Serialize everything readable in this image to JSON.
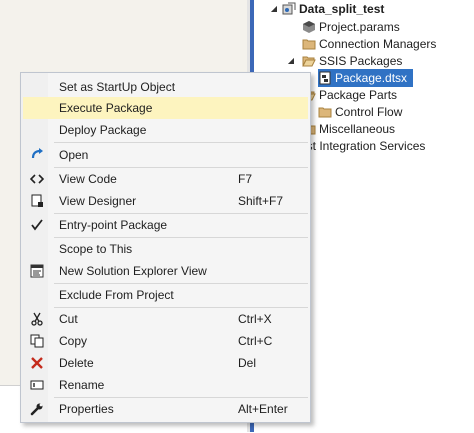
{
  "solution_explorer": {
    "project": "Data_split_test",
    "project_params": "Project.params",
    "connection_managers": "Connection Managers",
    "ssis_packages": "SSIS Packages",
    "package": "Package.dtsx",
    "package_parts": "Package Parts",
    "control_flow": "Control Flow",
    "miscellaneous": "Miscellaneous",
    "integration_services_partial": "est Integration Services"
  },
  "context_menu": {
    "set_startup": "Set as StartUp Object",
    "execute_package": "Execute Package",
    "deploy_package": "Deploy Package",
    "open": "Open",
    "view_code": "View Code",
    "view_code_shortcut": "F7",
    "view_designer": "View Designer",
    "view_designer_shortcut": "Shift+F7",
    "entry_point": "Entry-point Package",
    "scope_to_this": "Scope to This",
    "new_solution_explorer_view": "New Solution Explorer View",
    "exclude_from_project": "Exclude From Project",
    "cut": "Cut",
    "cut_shortcut": "Ctrl+X",
    "copy": "Copy",
    "copy_shortcut": "Ctrl+C",
    "delete": "Delete",
    "delete_shortcut": "Del",
    "rename": "Rename",
    "properties": "Properties",
    "properties_shortcut": "Alt+Enter"
  },
  "colors": {
    "selection": "#3072c4",
    "menu_hover": "#fdf4bf",
    "delete_icon": "#c42b1c",
    "open_icon": "#1f6fc4"
  }
}
